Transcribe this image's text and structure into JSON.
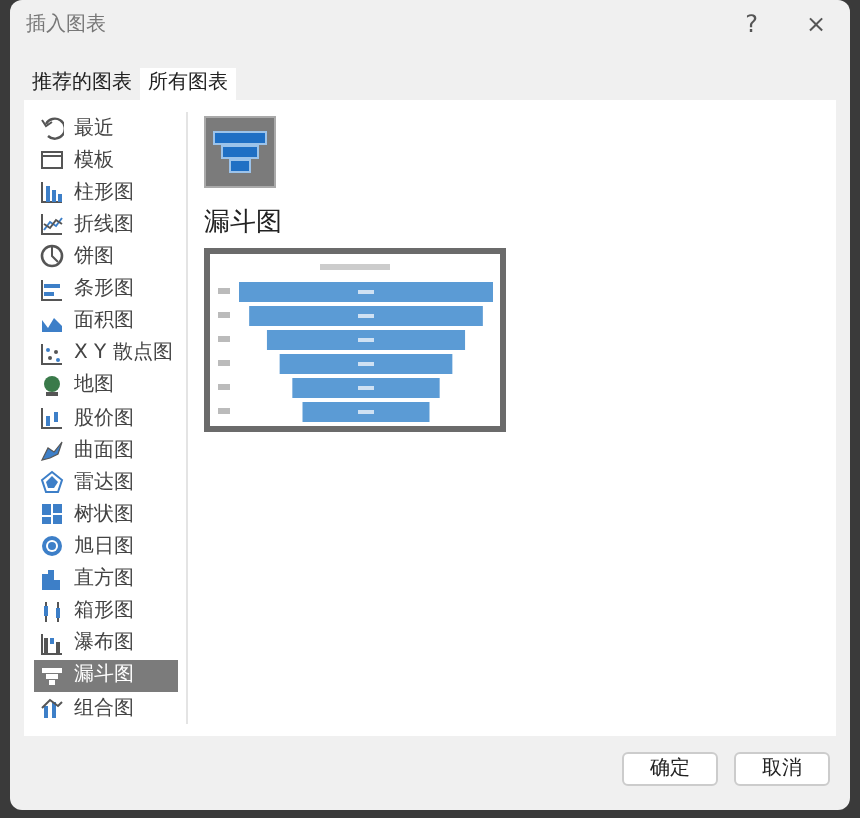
{
  "window": {
    "title": "插入图表",
    "help": "?",
    "close": "×"
  },
  "tabs": [
    {
      "label": "推荐的图表",
      "selected": false
    },
    {
      "label": "所有图表",
      "selected": true
    }
  ],
  "chart_types": [
    {
      "label": "最近",
      "selected": false
    },
    {
      "label": "模板",
      "selected": false
    },
    {
      "label": "柱形图",
      "selected": false
    },
    {
      "label": "折线图",
      "selected": false
    },
    {
      "label": "饼图",
      "selected": false
    },
    {
      "label": "条形图",
      "selected": false
    },
    {
      "label": "面积图",
      "selected": false
    },
    {
      "label": "X Y 散点图",
      "selected": false
    },
    {
      "label": "地图",
      "selected": false
    },
    {
      "label": "股价图",
      "selected": false
    },
    {
      "label": "曲面图",
      "selected": false
    },
    {
      "label": "雷达图",
      "selected": false
    },
    {
      "label": "树状图",
      "selected": false
    },
    {
      "label": "旭日图",
      "selected": false
    },
    {
      "label": "直方图",
      "selected": false
    },
    {
      "label": "箱形图",
      "selected": false
    },
    {
      "label": "瀑布图",
      "selected": false
    },
    {
      "label": "漏斗图",
      "selected": true
    },
    {
      "label": "组合图",
      "selected": false
    }
  ],
  "detail": {
    "heading": "漏斗图"
  },
  "buttons": [
    {
      "label": "确定"
    },
    {
      "label": "取消"
    }
  ]
}
